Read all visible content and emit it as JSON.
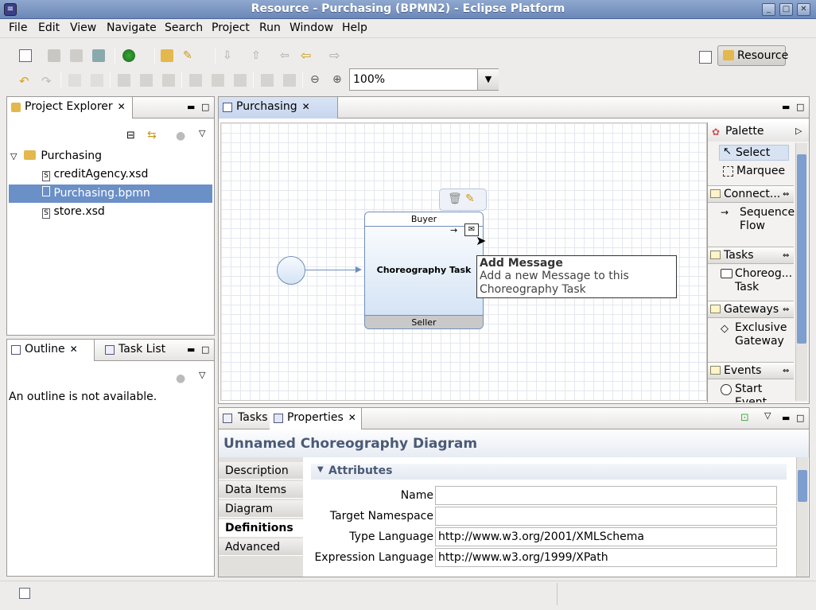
{
  "window": {
    "title": "Resource - Purchasing (BPMN2) - Eclipse Platform"
  },
  "menu": [
    "File",
    "Edit",
    "View",
    "Navigate",
    "Search",
    "Project",
    "Run",
    "Window",
    "Help"
  ],
  "toolbar": {
    "zoom_value": "100%",
    "perspective_label": "Resource"
  },
  "project_explorer": {
    "tab_label": "Project Explorer",
    "root": "Purchasing",
    "items": [
      "creditAgency.xsd",
      "Purchasing.bpmn",
      "store.xsd"
    ]
  },
  "outline": {
    "tab_label": "Outline",
    "task_list_label": "Task List",
    "message": "An outline is not available."
  },
  "editor": {
    "tab_label": "Purchasing",
    "task_top_participant": "Buyer",
    "task_name": "Choreography Task",
    "task_bottom_participant": "Seller",
    "tooltip_title": "Add Message",
    "tooltip_text": "Add a new Message to this Choreography Task"
  },
  "palette": {
    "title": "Palette",
    "tools": [
      "Select",
      "Marquee"
    ],
    "groups": [
      {
        "name": "Connect...",
        "item": "Sequence Flow"
      },
      {
        "name": "Tasks",
        "item": "Choreog... Task"
      },
      {
        "name": "Gateways",
        "item": "Exclusive Gateway"
      },
      {
        "name": "Events",
        "item": "Start Event"
      }
    ]
  },
  "bottom_panel": {
    "tabs": [
      "Tasks",
      "Properties"
    ],
    "title": "Unnamed Choreography Diagram",
    "side_tabs": [
      "Description",
      "Data Items",
      "Diagram",
      "Definitions",
      "Advanced"
    ],
    "active_side_tab": "Definitions",
    "section_title": "Attributes",
    "fields": [
      {
        "label": "Name",
        "value": ""
      },
      {
        "label": "Target Namespace",
        "value": ""
      },
      {
        "label": "Type Language",
        "value": "http://www.w3.org/2001/XMLSchema"
      },
      {
        "label": "Expression Language",
        "value": "http://www.w3.org/1999/XPath"
      }
    ]
  },
  "colors": {
    "selection": "#6b8fc7",
    "title_text": "#4a5a76"
  }
}
